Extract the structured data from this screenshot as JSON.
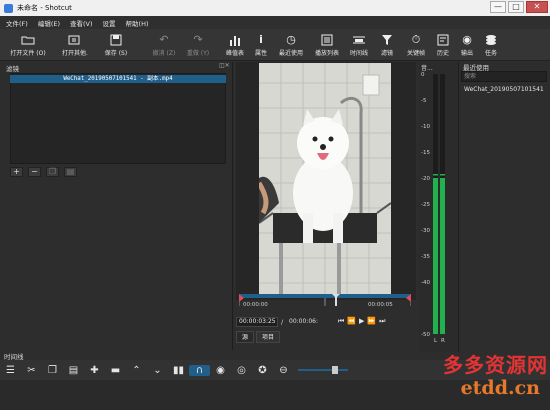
{
  "window": {
    "title": "未命名 - Shotcut",
    "controls": {
      "minimize": "—",
      "maximize": "□",
      "close": "✕"
    }
  },
  "menu": [
    "文件(F)",
    "编辑(E)",
    "查看(V)",
    "设置",
    "帮助(H)"
  ],
  "toolbar": {
    "open_file": "打开文件 (O)",
    "open_other": "打开其他.",
    "save": "保存 (S)",
    "undo": "撤消 (Z)",
    "redo": "重做 (Y)",
    "peak_meter": "峰值表",
    "properties": "属性",
    "recent": "最近使用",
    "playlist": "播放列表",
    "timeline": "时间线",
    "filters": "滤镜",
    "keyframes": "关键帧",
    "history": "历史",
    "export": "输出",
    "jobs": "任务"
  },
  "filters_panel": {
    "title": "滤镜",
    "selected_clip": "WeChat_20190507101541 - 副本.mp4",
    "buttons": [
      "+",
      "−",
      "copy",
      "paste"
    ]
  },
  "player": {
    "ruler_start": "00:00:00",
    "ruler_end": "00:00:05",
    "position": "00:00:03:25",
    "duration_sep": "/",
    "duration": "00:00:06:",
    "tabs": [
      "源",
      "项目"
    ],
    "selected_tab": "源"
  },
  "meter": {
    "title": "音...",
    "scale": [
      "0",
      "-5",
      "-10",
      "-15",
      "-20",
      "-25",
      "-30",
      "-35",
      "-40",
      "-50"
    ],
    "channels": [
      "L",
      "R"
    ],
    "levels": {
      "L": -20,
      "R": -20
    }
  },
  "recent_panel": {
    "title": "最近使用",
    "search_placeholder": "搜索",
    "items": [
      "WeChat_20190507101541"
    ]
  },
  "timeline": {
    "title": "时间线"
  },
  "watermark": {
    "line1": "多多资源网",
    "line2": "etdd.cn"
  },
  "colors": {
    "accent": "#1f5f8a",
    "meter_green": "#22b14c",
    "playhead_red": "#e04a5a"
  }
}
